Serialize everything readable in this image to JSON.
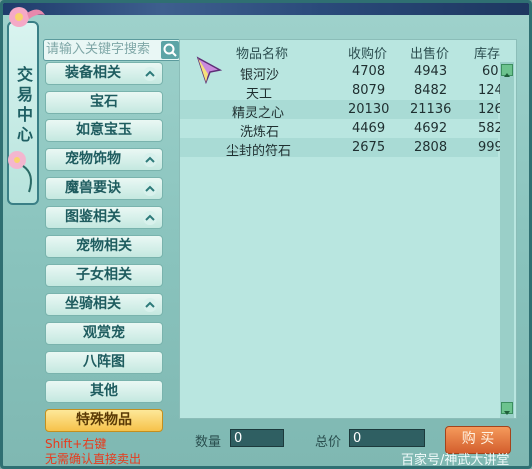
{
  "sidebar": {
    "title": "交易中心",
    "search_placeholder": "请输入关键字搜索",
    "categories": [
      {
        "label": "装备相关",
        "expandable": true
      },
      {
        "label": "宝石",
        "expandable": false
      },
      {
        "label": "如意宝玉",
        "expandable": false
      },
      {
        "label": "宠物饰物",
        "expandable": true
      },
      {
        "label": "魔兽要诀",
        "expandable": true
      },
      {
        "label": "图鉴相关",
        "expandable": true
      },
      {
        "label": "宠物相关",
        "expandable": false
      },
      {
        "label": "子女相关",
        "expandable": false
      },
      {
        "label": "坐骑相关",
        "expandable": true
      },
      {
        "label": "观赏宠",
        "expandable": false
      },
      {
        "label": "八阵图",
        "expandable": false
      },
      {
        "label": "其他",
        "expandable": false
      },
      {
        "label": "特殊物品",
        "expandable": false,
        "selected": true
      }
    ],
    "hint_line1": "Shift+右键",
    "hint_line2": "无需确认直接卖出"
  },
  "table": {
    "headers": [
      "物品名称",
      "收购价",
      "出售价",
      "库存"
    ],
    "rows": [
      [
        "银河沙",
        "4708",
        "4943",
        "60"
      ],
      [
        "天工",
        "8079",
        "8482",
        "124"
      ],
      [
        "精灵之心",
        "20130",
        "21136",
        "126"
      ],
      [
        "洗炼石",
        "4469",
        "4692",
        "582"
      ],
      [
        "尘封的符石",
        "2675",
        "2808",
        "999"
      ]
    ]
  },
  "bottom": {
    "qty_label": "数量",
    "qty_value": "0",
    "total_label": "总价",
    "total_value": "0",
    "buy_label": "购 买"
  },
  "watermark": "百家号/神武大讲堂"
}
